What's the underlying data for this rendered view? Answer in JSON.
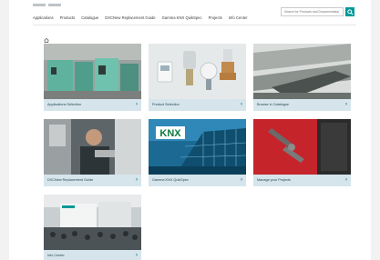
{
  "header": {
    "nav": [
      "Applications",
      "Products",
      "Catalogue",
      "DXCNew Replacement Guide",
      "Gamma KNX QuikSpec",
      "Projects",
      "Info Center"
    ],
    "search_placeholder": "Search for Products and Documentation",
    "search_icon": "search-icon",
    "home_icon": "home-icon"
  },
  "tiles": [
    {
      "label": "Applications Selection",
      "icon": "chevron-right-icon"
    },
    {
      "label": "Product Selection",
      "icon": "chevron-right-icon"
    },
    {
      "label": "Browse in Catalogue",
      "icon": "chevron-right-icon"
    },
    {
      "label": "DXCNew Replacement Guide",
      "icon": "chevron-right-icon"
    },
    {
      "label": "Gamma KNX QuikSpec",
      "icon": "chevron-right-icon"
    },
    {
      "label": "Manage your Projects",
      "icon": "chevron-right-icon"
    },
    {
      "label": "Info Center",
      "icon": "chevron-right-icon"
    }
  ],
  "knx_logo_text": "KNX",
  "colors": {
    "accent": "#009999",
    "tile_bar": "#d6e5ec",
    "chevron": "#1f6f86"
  }
}
